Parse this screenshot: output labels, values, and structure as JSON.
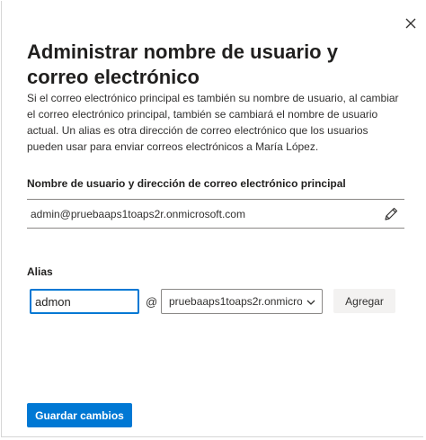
{
  "dialog": {
    "title": "Administrar nombre de usuario y correo electrónico",
    "description": "Si el correo electrónico principal es también su nombre de usuario, al cambiar el correo electrónico principal, también se cambiará el nombre de usuario actual. Un alias es otra dirección de correo electrónico que los usuarios pueden usar para enviar correos electrónicos a María López."
  },
  "primary": {
    "label": "Nombre de usuario y dirección de correo electrónico principal",
    "value": "admin@pruebaaps1toaps2r.onmicrosoft.com"
  },
  "alias": {
    "label": "Alias",
    "input_value": "admon",
    "at_symbol": "@",
    "domain_selected": "pruebaaps1toaps2r.onmicro...",
    "add_label": "Agregar"
  },
  "footer": {
    "save_label": "Guardar cambios"
  },
  "colors": {
    "accent": "#0078d4",
    "secondary_button": "#f3f2f1"
  },
  "icons": {
    "close": "close-icon",
    "edit": "pencil-icon",
    "dropdown": "chevron-down-icon"
  }
}
